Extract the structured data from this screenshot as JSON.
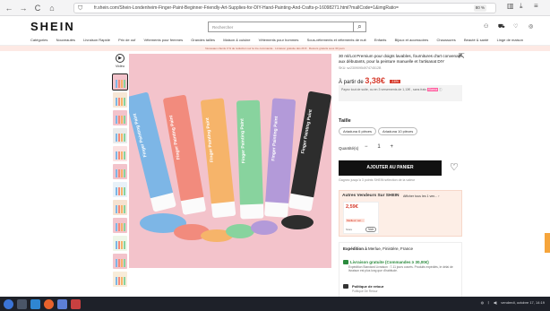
{
  "browser": {
    "url": "fr.shein.com/Shein-Londenheim-Finger-Paint-Beginner-Friendly-Art-Supplies-for-DIY-Hand-Painting-And-Crafts-p-16098271.html?mallCode=1&imgRatio=",
    "zoom": "80 %",
    "nav_back": "←",
    "nav_forward": "→",
    "nav_reload": "C",
    "nav_home": "⌂"
  },
  "header": {
    "logo": "SHEIN",
    "search_placeholder": "Rechercher",
    "icons": [
      "user-icon",
      "cart-icon",
      "heart-icon",
      "globe-icon"
    ]
  },
  "categories": [
    "Catégories",
    "Nouveautés",
    "Livraison Rapide",
    "Prix de ouf",
    "Vêtements pour femmes",
    "Grandes tailles",
    "Maison & cuisine",
    "Vêtements pour hommes",
    "Sous-vêtements et vêtements de nuit",
    "Enfants",
    "Bijoux et accessoires",
    "Chaussures",
    "Beauté & santé",
    "Linge de maison"
  ],
  "promo": "Nouveaux clients 3 % de réduction sur la 1re commande · Livraison gratuite dès 29 € · Retours gratuits sous 30 jours",
  "gallery": {
    "video_label": "Vidéo",
    "thumb_count": 12,
    "tube_labels": [
      "Finger Painting Paint",
      "Finger Painting Paint",
      "Finger Painting Paint",
      "Finger Painting Paint",
      "Finger Painting Paint",
      "Finger Painting Paint"
    ]
  },
  "product": {
    "title": "30 ml/Lot Premium pour doigts lavables, fournitures d'art convenant aux débutants, pour la peinture manuelle et l'artisanat DIY",
    "sku": "SKU: sz2309095497474512B",
    "price_prefix": "À partir de",
    "price": "3,38€",
    "price_badge": "",
    "promo_box": "Payez tout de suite, ou en 3 versements de 1,13€ , sans frais",
    "promo_pill": "Klarna",
    "size_label": "Taille",
    "sizes": [
      "Ariaduna 6 pièces",
      "Ariaduna 10 pièces"
    ],
    "qty_label": "Quantité(s)",
    "qty_minus": "−",
    "qty_value": "1",
    "qty_plus": "+",
    "add_to_cart": "AJOUTER AU PANIER",
    "note": "Gagnez jusqu'à 3 points SHEIN sélection de la valeur"
  },
  "sellers": {
    "heading": "Autres Vendeurs Sur SHEIN",
    "link": "Afficher tous les 1 ven... ›",
    "card_price": "2,59€",
    "card_badge": "Meilleur ven...",
    "card_store": "Store",
    "card_button": "Voir"
  },
  "shipping": {
    "heading_prefix": "Expédition à",
    "heading_location": "Merlue, Finistère, France",
    "line": "Livraison gratuite (Commandes ≥ 30,00€)",
    "line_detail": "Expédition Standard Livraison : 7-11 jours ouvrés. Produits expédiés, le délai de livraison est plus long que d'habitude.",
    "return_title": "Politique de retour",
    "return_detail": "Politique De Retour"
  },
  "taskbar": {
    "tray_text": "vendredi, octobre 17, 14:19"
  },
  "colors": {
    "accent": "#d63a2b",
    "brand": "#111111",
    "bg_image": "#f3c3cb"
  }
}
